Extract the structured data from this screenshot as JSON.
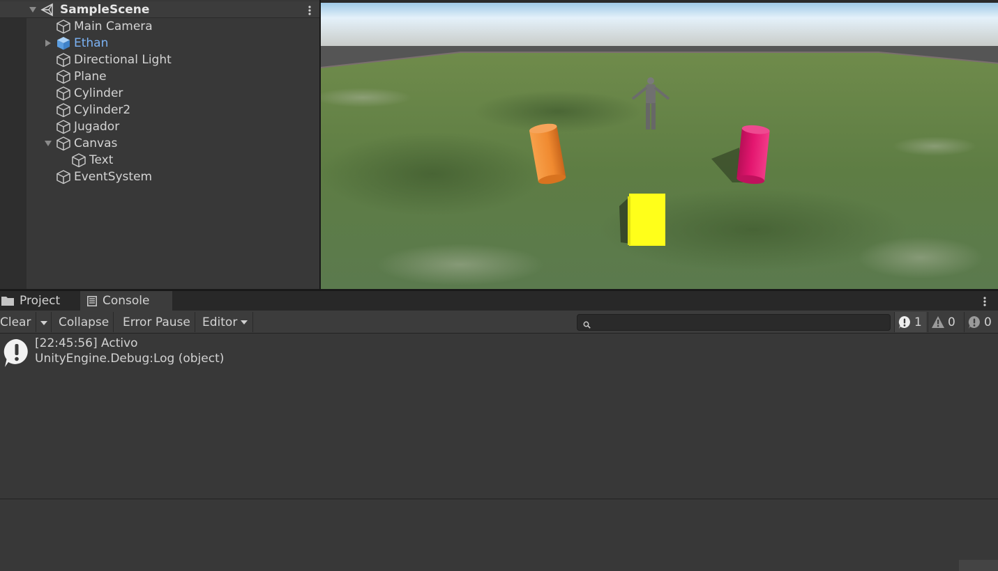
{
  "hierarchy": {
    "scene_name": "SampleScene",
    "items": [
      {
        "label": "Main Camera",
        "indent": 1,
        "expander": "none",
        "prefab": false
      },
      {
        "label": "Ethan",
        "indent": 1,
        "expander": "collapsed",
        "prefab": true
      },
      {
        "label": "Directional Light",
        "indent": 1,
        "expander": "none",
        "prefab": false
      },
      {
        "label": "Plane",
        "indent": 1,
        "expander": "none",
        "prefab": false
      },
      {
        "label": "Cylinder",
        "indent": 1,
        "expander": "none",
        "prefab": false
      },
      {
        "label": "Cylinder2",
        "indent": 1,
        "expander": "none",
        "prefab": false
      },
      {
        "label": "Jugador",
        "indent": 1,
        "expander": "none",
        "prefab": false
      },
      {
        "label": "Canvas",
        "indent": 1,
        "expander": "expanded",
        "prefab": false
      },
      {
        "label": "Text",
        "indent": 2,
        "expander": "none",
        "prefab": false
      },
      {
        "label": "EventSystem",
        "indent": 1,
        "expander": "none",
        "prefab": false
      }
    ]
  },
  "scene_view": {
    "objects": [
      "Ethan",
      "Cylinder",
      "Cylinder2",
      "Jugador"
    ],
    "colors": {
      "sky_top": "#dceefa",
      "grass": "#5f7f42",
      "orange_cylinder": "#f08a30",
      "pink_cylinder": "#e3166f",
      "yellow_cube": "#ffff1a",
      "character": "#6e6e6e"
    }
  },
  "bottom_panel": {
    "tabs": [
      {
        "label": "Project",
        "active": false,
        "icon": "folder-icon"
      },
      {
        "label": "Console",
        "active": true,
        "icon": "console-icon"
      }
    ]
  },
  "toolbar": {
    "clear_label": "Clear",
    "collapse_label": "Collapse",
    "error_pause_label": "Error Pause",
    "editor_label": "Editor",
    "search_value": "",
    "counts": {
      "log": "1",
      "warning": "0",
      "error": "0"
    }
  },
  "console": {
    "entries": [
      {
        "line1": "[22:45:56] Activo",
        "line2": "UnityEngine.Debug:Log (object)",
        "type": "info"
      }
    ]
  }
}
